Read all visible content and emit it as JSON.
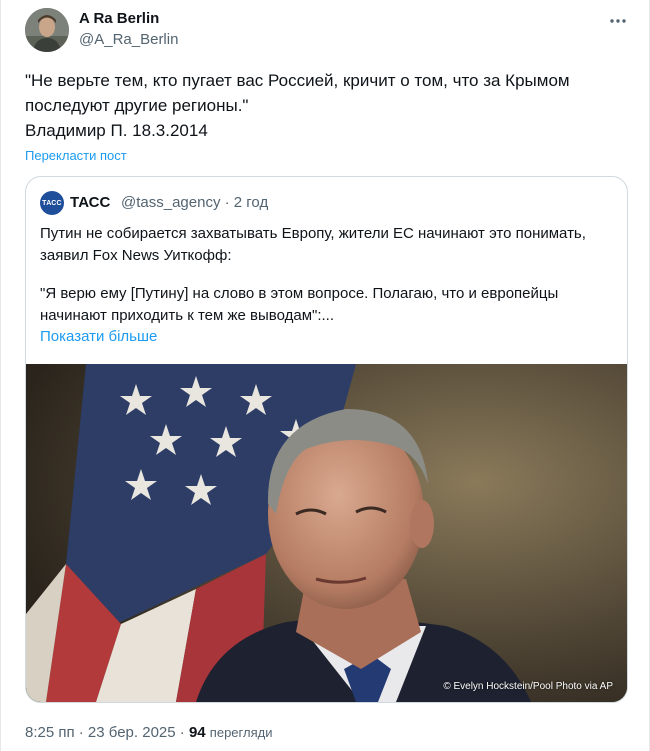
{
  "author": {
    "name": "A Ra Berlin",
    "handle": "@A_Ra_Berlin",
    "avatar_icon": "profile-photo"
  },
  "more_icon": "more-horizontal-icon",
  "tweet": {
    "lines": [
      "\"Не верьте тем, кто пугает вас Россией, кричит о том, что за Крымом",
      "последуют другие регионы.\"",
      "Владимир П. 18.3.2014"
    ],
    "translate_label": "Перекласти пост"
  },
  "quote": {
    "avatar_text": "ТАСС",
    "name": "ТАСС",
    "handle_time": "@tass_agency · 2 год",
    "lines_1": [
      "Путин не собирается захватывать Европу, жители ЕС начинают это понимать,",
      "заявил Fox News Уиткофф:"
    ],
    "lines_2": [
      "\"Я верю ему [Путину] на слово в этом вопросе. Полагаю, что и европейцы",
      "начинают приходить к тем же выводам\":..."
    ],
    "show_more": "Показати більше",
    "photo_credit": "© Evelyn Hockstein/Pool Photo via AP"
  },
  "meta": {
    "time_date": "8:25 пп · 23 бер. 2025 · ",
    "views_count": "94",
    "views_label": "перегляди"
  },
  "colors": {
    "link": "#1d9bf0",
    "secondary_text": "#536471",
    "primary_text": "#0f1419",
    "border": "#cfd9de",
    "tass_blue": "#1f4f9a"
  }
}
